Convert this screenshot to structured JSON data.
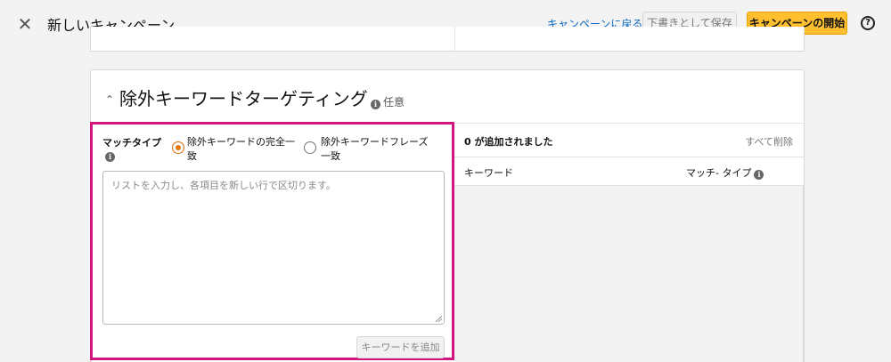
{
  "header": {
    "title": "新しいキャンペーン",
    "back_link": "キャンペーンに戻る",
    "save_draft": "下書きとして保存",
    "start_campaign": "キャンペーンの開始",
    "help_glyph": "?",
    "close_glyph": "✕"
  },
  "section": {
    "title": "除外キーワードターゲティング",
    "optional_label": "任意",
    "chevron": "⌃"
  },
  "match_type": {
    "label": "マッチタイプ",
    "options": [
      {
        "label": "除外キーワードの完全一致",
        "selected": true
      },
      {
        "label": "除外キーワードフレーズ一致",
        "selected": false
      }
    ]
  },
  "keyword_input": {
    "placeholder": "リストを入力し、各項目を新しい行で区切ります。",
    "value": ""
  },
  "add_button": "キーワードを追加",
  "added_list": {
    "count_text": "0 が追加されました",
    "remove_all": "すべて削除",
    "columns": [
      "キーワード",
      "マッチ- タイプ"
    ]
  },
  "colors": {
    "accent_orange": "#ffbf2e",
    "highlight_border": "#d2167f",
    "link_blue": "#0b66c2",
    "radio_selected": "#e47911"
  }
}
